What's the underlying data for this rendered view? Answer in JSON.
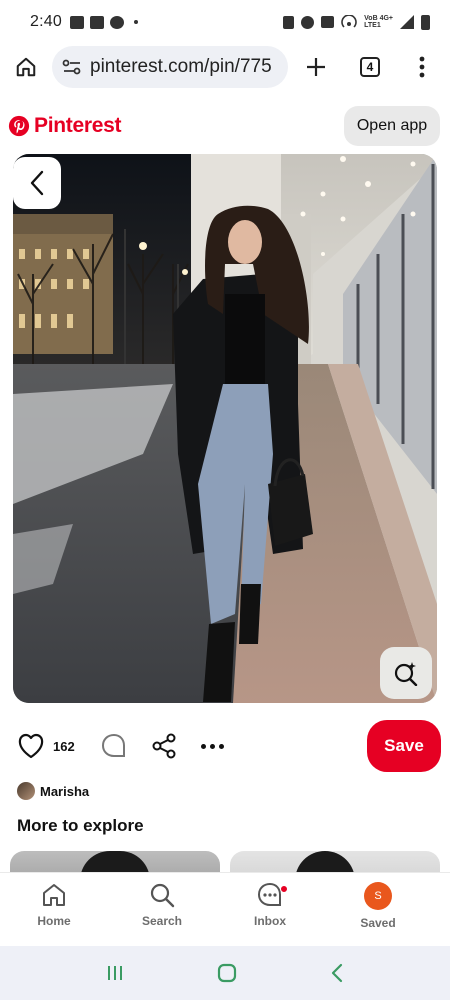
{
  "status_bar": {
    "time": "2:40",
    "network_top": "VoB 4G+",
    "network_bottom": "LTE1"
  },
  "browser": {
    "url": "pinterest.com/pin/775",
    "tab_count": "4"
  },
  "header": {
    "logo_text": "Pinterest",
    "open_app_label": "Open app",
    "brand_color": "#e60023"
  },
  "pin": {
    "like_count": "162",
    "save_label": "Save",
    "creator_name": "Marisha"
  },
  "explore": {
    "title": "More to explore"
  },
  "bottom_nav": {
    "items": [
      {
        "label": "Home",
        "icon": "home-icon"
      },
      {
        "label": "Search",
        "icon": "search-icon"
      },
      {
        "label": "Inbox",
        "icon": "inbox-icon"
      },
      {
        "label": "Saved",
        "icon": "profile-avatar"
      }
    ],
    "saved_initial": "S"
  }
}
